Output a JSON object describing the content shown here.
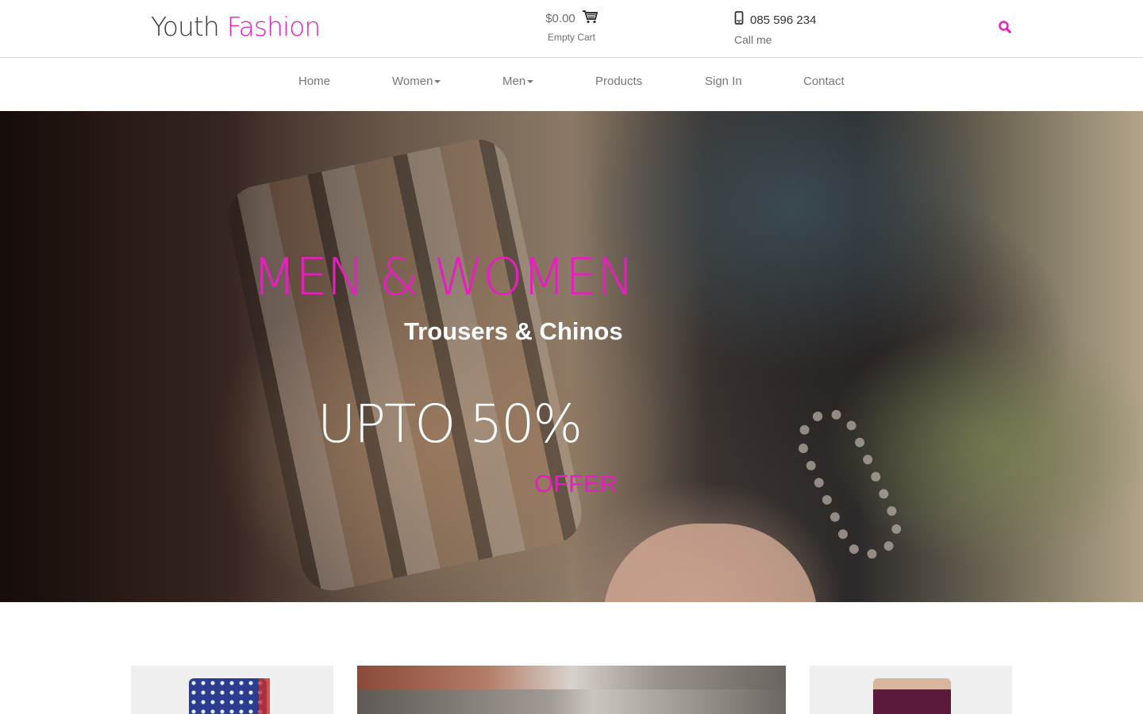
{
  "brand": {
    "word1": "Youth",
    "word2": "Fashion"
  },
  "cart": {
    "price": "$0.00",
    "status": "Empty Cart",
    "icon": "cart-icon"
  },
  "contact": {
    "phone": "085 596 234",
    "label": "Call me",
    "icon": "mobile-phone-icon"
  },
  "search": {
    "icon": "search-icon"
  },
  "nav": {
    "items": [
      {
        "label": "Home",
        "dropdown": false
      },
      {
        "label": "Women",
        "dropdown": true
      },
      {
        "label": "Men",
        "dropdown": true
      },
      {
        "label": "Products",
        "dropdown": false
      },
      {
        "label": "Sign In",
        "dropdown": false
      },
      {
        "label": "Contact",
        "dropdown": false
      }
    ]
  },
  "hero": {
    "title": "MEN & WOMEN",
    "subtitle": "Trousers & Chinos",
    "promo": "UPTO 50%",
    "offer": "OFFER"
  },
  "colors": {
    "accent": "#e91dc1",
    "text": "#777777",
    "border": "#d9d9d9"
  }
}
